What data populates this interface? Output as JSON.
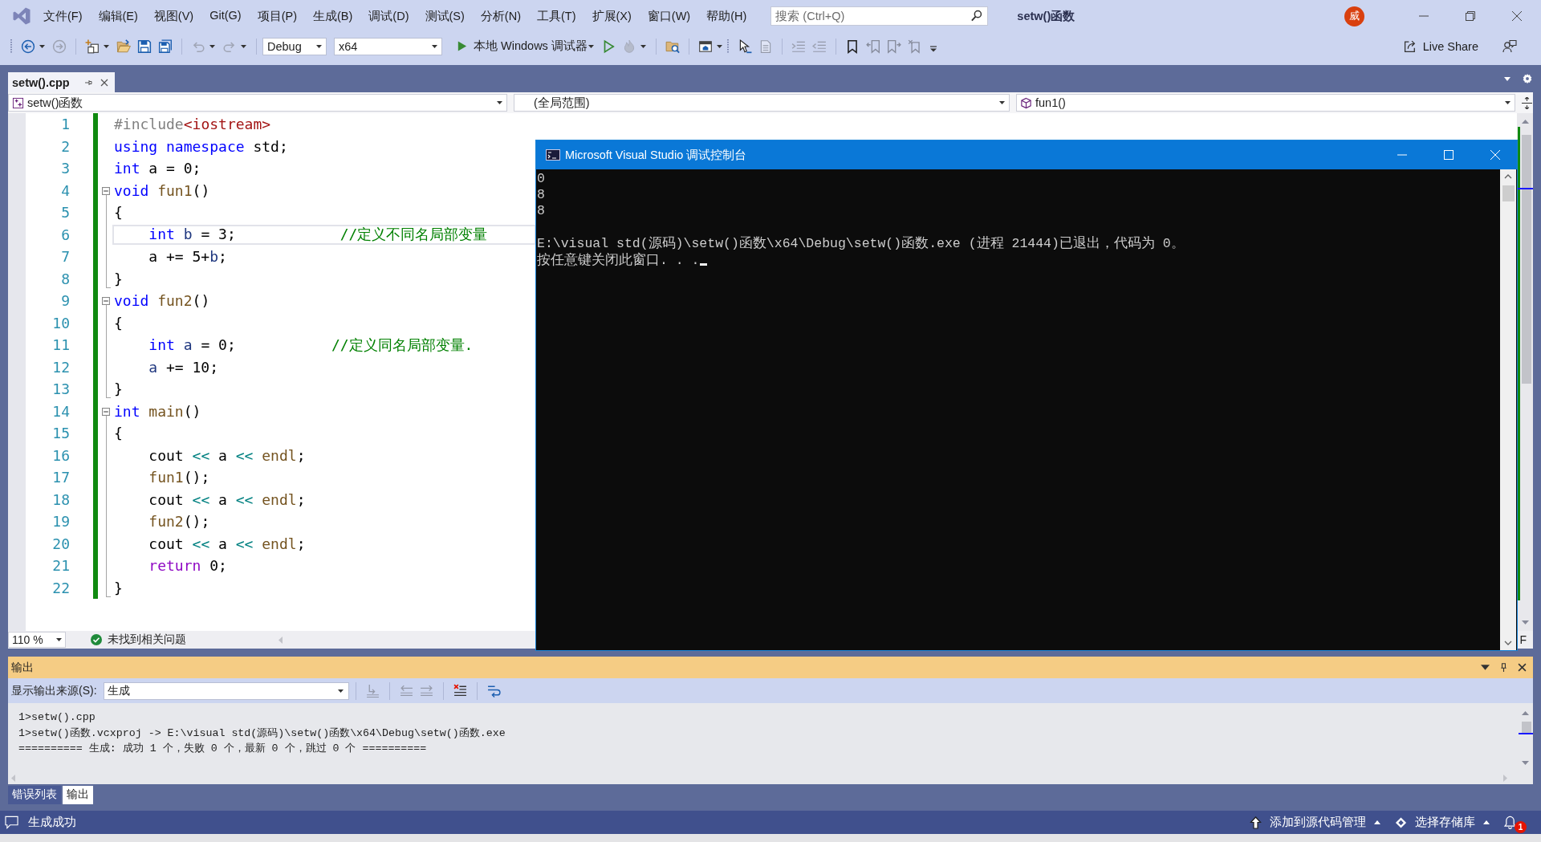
{
  "titlebar": {
    "menu": [
      "文件(F)",
      "编辑(E)",
      "视图(V)",
      "Git(G)",
      "项目(P)",
      "生成(B)",
      "调试(D)",
      "测试(S)",
      "分析(N)",
      "工具(T)",
      "扩展(X)",
      "窗口(W)",
      "帮助(H)"
    ],
    "search": {
      "placeholder": "搜索 (Ctrl+Q)"
    },
    "title": "setw()函数",
    "avatar": "威"
  },
  "toolbar": {
    "items": [
      {
        "kind": "gripper"
      },
      {
        "kind": "back",
        "disabled": false,
        "dropdown": true
      },
      {
        "kind": "forward",
        "disabled": true,
        "dropdown": false
      },
      {
        "kind": "separator"
      },
      {
        "kind": "new-item",
        "disabled": false,
        "dropdown": true
      },
      {
        "kind": "open",
        "disabled": false,
        "dropdown": false
      },
      {
        "kind": "save",
        "disabled": false,
        "dropdown": false
      },
      {
        "kind": "save-all",
        "disabled": false,
        "dropdown": false
      },
      {
        "kind": "separator"
      },
      {
        "kind": "undo",
        "disabled": true,
        "dropdown": true
      },
      {
        "kind": "redo",
        "disabled": true,
        "dropdown": true
      },
      {
        "kind": "separator"
      },
      {
        "kind": "combo",
        "value": "Debug"
      },
      {
        "kind": "combo",
        "value": "x64"
      },
      {
        "kind": "run",
        "label": "本地 Windows 调试器",
        "dropdown": true
      },
      {
        "kind": "run-outline",
        "disabled": false,
        "dropdown": false
      },
      {
        "kind": "hot-reload",
        "disabled": true,
        "dropdown": true
      },
      {
        "kind": "separator"
      },
      {
        "kind": "find-folder",
        "disabled": false,
        "dropdown": false
      },
      {
        "kind": "separator"
      },
      {
        "kind": "window",
        "disabled": false,
        "dropdown": true
      },
      {
        "kind": "gripper"
      },
      {
        "kind": "pointer",
        "disabled": false,
        "dropdown": false
      },
      {
        "kind": "document",
        "disabled": true,
        "dropdown": false
      },
      {
        "kind": "separator"
      },
      {
        "kind": "indent",
        "disabled": true,
        "dropdown": false
      },
      {
        "kind": "outdent",
        "disabled": true,
        "dropdown": false
      },
      {
        "kind": "separator"
      },
      {
        "kind": "bookmark",
        "disabled": false,
        "dropdown": false
      },
      {
        "kind": "bookmark-prev",
        "disabled": true,
        "dropdown": false
      },
      {
        "kind": "bookmark-next",
        "disabled": true,
        "dropdown": false
      },
      {
        "kind": "bookmark-clear",
        "disabled": true,
        "dropdown": false
      },
      {
        "kind": "overflow"
      }
    ],
    "live_share": "Live Share"
  },
  "doc_tabs": [
    {
      "label": "setw().cpp",
      "selected": true
    }
  ],
  "nav_bar": {
    "project": "setw()函数",
    "scope": "(全局范围)",
    "member": "fun1()"
  },
  "editor": {
    "lines": [
      {
        "number": "1",
        "changed": true,
        "current": false,
        "tokens": [
          {
            "kind": "preprocessor",
            "text": "#include"
          },
          {
            "kind": "string",
            "text": "<iostream>"
          }
        ]
      },
      {
        "number": "2",
        "changed": true,
        "current": false,
        "tokens": [
          {
            "kind": "keyword",
            "text": "using"
          },
          {
            "kind": "keyword",
            "text": " namespace"
          },
          {
            "kind": "plain",
            "text": " std;"
          }
        ]
      },
      {
        "number": "3",
        "changed": true,
        "current": false,
        "tokens": [
          {
            "kind": "keyword",
            "text": "int"
          },
          {
            "kind": "plain",
            "text": " a = 0;"
          }
        ]
      },
      {
        "number": "4",
        "changed": true,
        "current": false,
        "expanded": true,
        "tokens": [
          {
            "kind": "keyword",
            "text": "void"
          },
          {
            "kind": "function",
            "text": " fun1"
          },
          {
            "kind": "plain",
            "text": "()"
          }
        ],
        "children": [
          {
            "number": "5",
            "changed": true,
            "current": false,
            "tokens": [
              {
                "kind": "plain",
                "text": "{"
              }
            ]
          },
          {
            "number": "6",
            "changed": true,
            "current": true,
            "tokens": [
              {
                "kind": "keyword",
                "text": "    int"
              },
              {
                "kind": "local",
                "text": " b"
              },
              {
                "kind": "plain",
                "text": " = 3;            "
              },
              {
                "kind": "comment",
                "text": "//定义不同名局部变量"
              }
            ]
          },
          {
            "number": "7",
            "changed": true,
            "current": false,
            "tokens": [
              {
                "kind": "plain",
                "text": "    a += 5+"
              },
              {
                "kind": "local",
                "text": "b"
              },
              {
                "kind": "plain",
                "text": ";"
              }
            ]
          },
          {
            "number": "8",
            "changed": true,
            "current": false,
            "tokens": [
              {
                "kind": "plain",
                "text": "}"
              }
            ]
          }
        ]
      },
      {
        "number": "9",
        "changed": true,
        "current": false,
        "expanded": true,
        "tokens": [
          {
            "kind": "keyword",
            "text": "void"
          },
          {
            "kind": "function",
            "text": " fun2"
          },
          {
            "kind": "plain",
            "text": "()"
          }
        ],
        "children": [
          {
            "number": "10",
            "changed": true,
            "current": false,
            "tokens": [
              {
                "kind": "plain",
                "text": "{"
              }
            ]
          },
          {
            "number": "11",
            "changed": true,
            "current": false,
            "tokens": [
              {
                "kind": "keyword",
                "text": "    int"
              },
              {
                "kind": "local",
                "text": " a"
              },
              {
                "kind": "plain",
                "text": " = 0;           "
              },
              {
                "kind": "comment",
                "text": "//定义同名局部变量."
              }
            ]
          },
          {
            "number": "12",
            "changed": true,
            "current": false,
            "tokens": [
              {
                "kind": "local",
                "text": "    a"
              },
              {
                "kind": "plain",
                "text": " += 10;"
              }
            ]
          },
          {
            "number": "13",
            "changed": true,
            "current": false,
            "tokens": [
              {
                "kind": "plain",
                "text": "}"
              }
            ]
          }
        ]
      },
      {
        "number": "14",
        "changed": true,
        "current": false,
        "expanded": true,
        "tokens": [
          {
            "kind": "keyword",
            "text": "int"
          },
          {
            "kind": "function",
            "text": " main"
          },
          {
            "kind": "plain",
            "text": "()"
          }
        ],
        "children": [
          {
            "number": "15",
            "changed": true,
            "current": false,
            "tokens": [
              {
                "kind": "plain",
                "text": "{"
              }
            ]
          },
          {
            "number": "16",
            "changed": true,
            "current": false,
            "tokens": [
              {
                "kind": "plain",
                "text": "    cout "
              },
              {
                "kind": "operator",
                "text": "<<"
              },
              {
                "kind": "plain",
                "text": " a "
              },
              {
                "kind": "operator",
                "text": "<<"
              },
              {
                "kind": "function",
                "text": " endl"
              },
              {
                "kind": "plain",
                "text": ";"
              }
            ]
          },
          {
            "number": "17",
            "changed": true,
            "current": false,
            "tokens": [
              {
                "kind": "function",
                "text": "    fun1"
              },
              {
                "kind": "plain",
                "text": "();"
              }
            ]
          },
          {
            "number": "18",
            "changed": true,
            "current": false,
            "tokens": [
              {
                "kind": "plain",
                "text": "    cout "
              },
              {
                "kind": "operator",
                "text": "<<"
              },
              {
                "kind": "plain",
                "text": " a "
              },
              {
                "kind": "operator",
                "text": "<<"
              },
              {
                "kind": "function",
                "text": " endl"
              },
              {
                "kind": "plain",
                "text": ";"
              }
            ]
          },
          {
            "number": "19",
            "changed": true,
            "current": false,
            "tokens": [
              {
                "kind": "function",
                "text": "    fun2"
              },
              {
                "kind": "plain",
                "text": "();"
              }
            ]
          },
          {
            "number": "20",
            "changed": true,
            "current": false,
            "tokens": [
              {
                "kind": "plain",
                "text": "    cout "
              },
              {
                "kind": "operator",
                "text": "<<"
              },
              {
                "kind": "plain",
                "text": " a "
              },
              {
                "kind": "operator",
                "text": "<<"
              },
              {
                "kind": "function",
                "text": " endl"
              },
              {
                "kind": "plain",
                "text": ";"
              }
            ]
          },
          {
            "number": "21",
            "changed": true,
            "current": false,
            "tokens": [
              {
                "kind": "control",
                "text": "    return"
              },
              {
                "kind": "plain",
                "text": " 0;"
              }
            ]
          },
          {
            "number": "22",
            "changed": true,
            "current": false,
            "tokens": [
              {
                "kind": "plain",
                "text": "}"
              }
            ]
          }
        ]
      }
    ]
  },
  "editor_footer": {
    "zoom": "110 %",
    "issues": {
      "ok": true,
      "text": "未找到相关问题"
    },
    "line_ending": "F"
  },
  "console": {
    "title": "Microsoft Visual Studio 调试控制台",
    "blocks": [
      [
        "0",
        "8",
        "8"
      ],
      [
        "E:\\visual std(源码)\\setw()函数\\x64\\Debug\\setw()函数.exe (进程 21444)已退出，代码为 0。",
        "按任意键关闭此窗口. . ."
      ]
    ],
    "cursor": true
  },
  "output": {
    "title": "输出",
    "source_label": "显示输出来源(S):",
    "source": "生成",
    "tools": [
      {
        "kind": "goto",
        "disabled": true
      },
      {
        "kind": "prev",
        "disabled": true
      },
      {
        "kind": "next",
        "disabled": true
      },
      {
        "kind": "clear",
        "disabled": false
      },
      {
        "kind": "wrap",
        "disabled": false
      }
    ],
    "lines": [
      "1>setw().cpp",
      "1>setw()函数.vcxproj -> E:\\visual std(源码)\\setw()函数\\x64\\Debug\\setw()函数.exe",
      "========== 生成: 成功 1 个，失败 0 个，最新 0 个，跳过 0 个 =========="
    ]
  },
  "bottom_tabs": [
    {
      "label": "错误列表",
      "selected": false
    },
    {
      "label": "输出",
      "selected": true
    }
  ],
  "status_bar": {
    "message": "生成成功",
    "items": [
      {
        "kind": "source-control",
        "label": "添加到源代码管理"
      },
      {
        "kind": "repository",
        "label": "选择存储库"
      }
    ],
    "notifications": "1"
  }
}
